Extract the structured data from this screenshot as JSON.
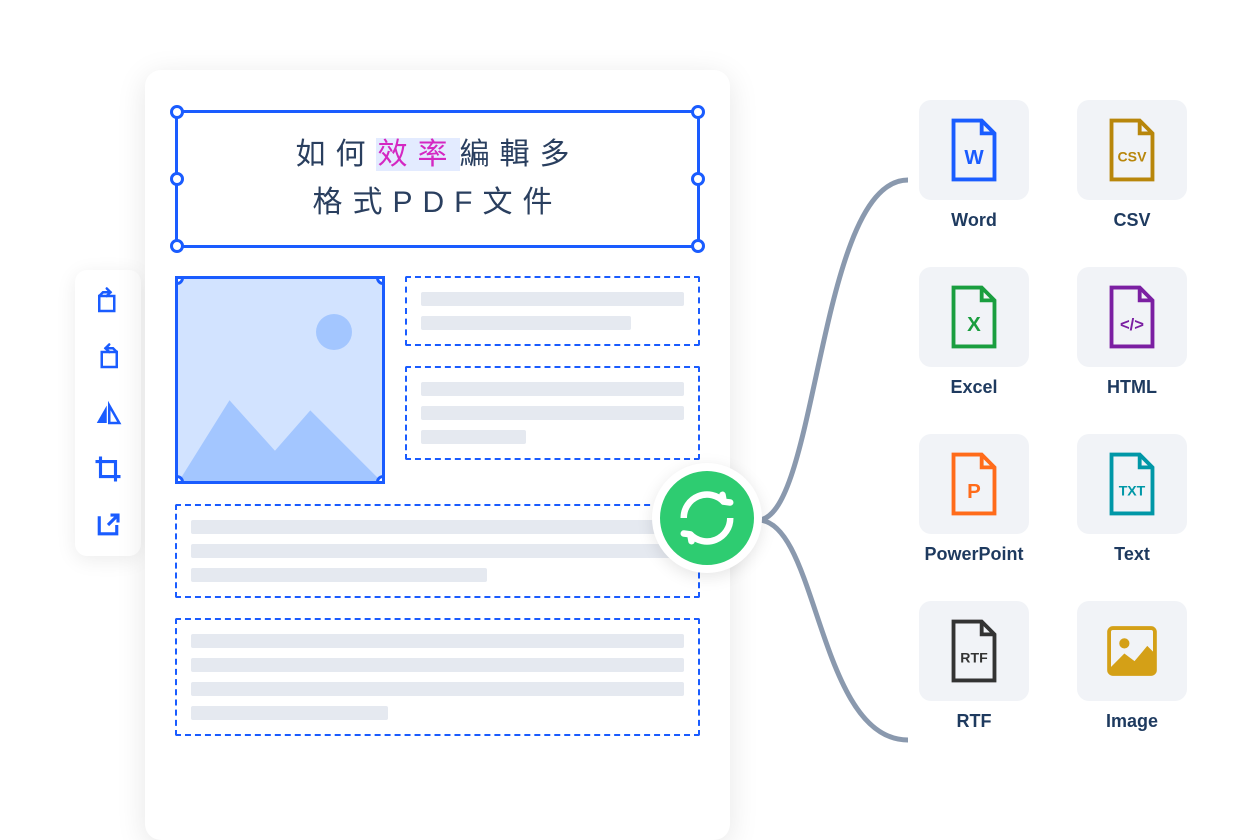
{
  "document": {
    "title_pre": "如何",
    "title_highlight": "效率",
    "title_post": "編輯多",
    "title_line2": "格式PDF文件"
  },
  "toolbar": {
    "items": [
      {
        "name": "rotate-right-icon"
      },
      {
        "name": "rotate-left-icon"
      },
      {
        "name": "flip-icon"
      },
      {
        "name": "crop-icon"
      },
      {
        "name": "export-icon"
      }
    ]
  },
  "formats": [
    {
      "label": "Word",
      "badge": "W",
      "color": "#1a5cff"
    },
    {
      "label": "CSV",
      "badge": "CSV",
      "color": "#b8860b"
    },
    {
      "label": "Excel",
      "badge": "X",
      "color": "#1a9e3f"
    },
    {
      "label": "HTML",
      "badge": "</>",
      "color": "#7b1fa2"
    },
    {
      "label": "PowerPoint",
      "badge": "P",
      "color": "#ff6b1a"
    },
    {
      "label": "Text",
      "badge": "TXT",
      "color": "#0097a7"
    },
    {
      "label": "RTF",
      "badge": "RTF",
      "color": "#333"
    },
    {
      "label": "Image",
      "badge": "",
      "color": "#d4a017"
    }
  ]
}
